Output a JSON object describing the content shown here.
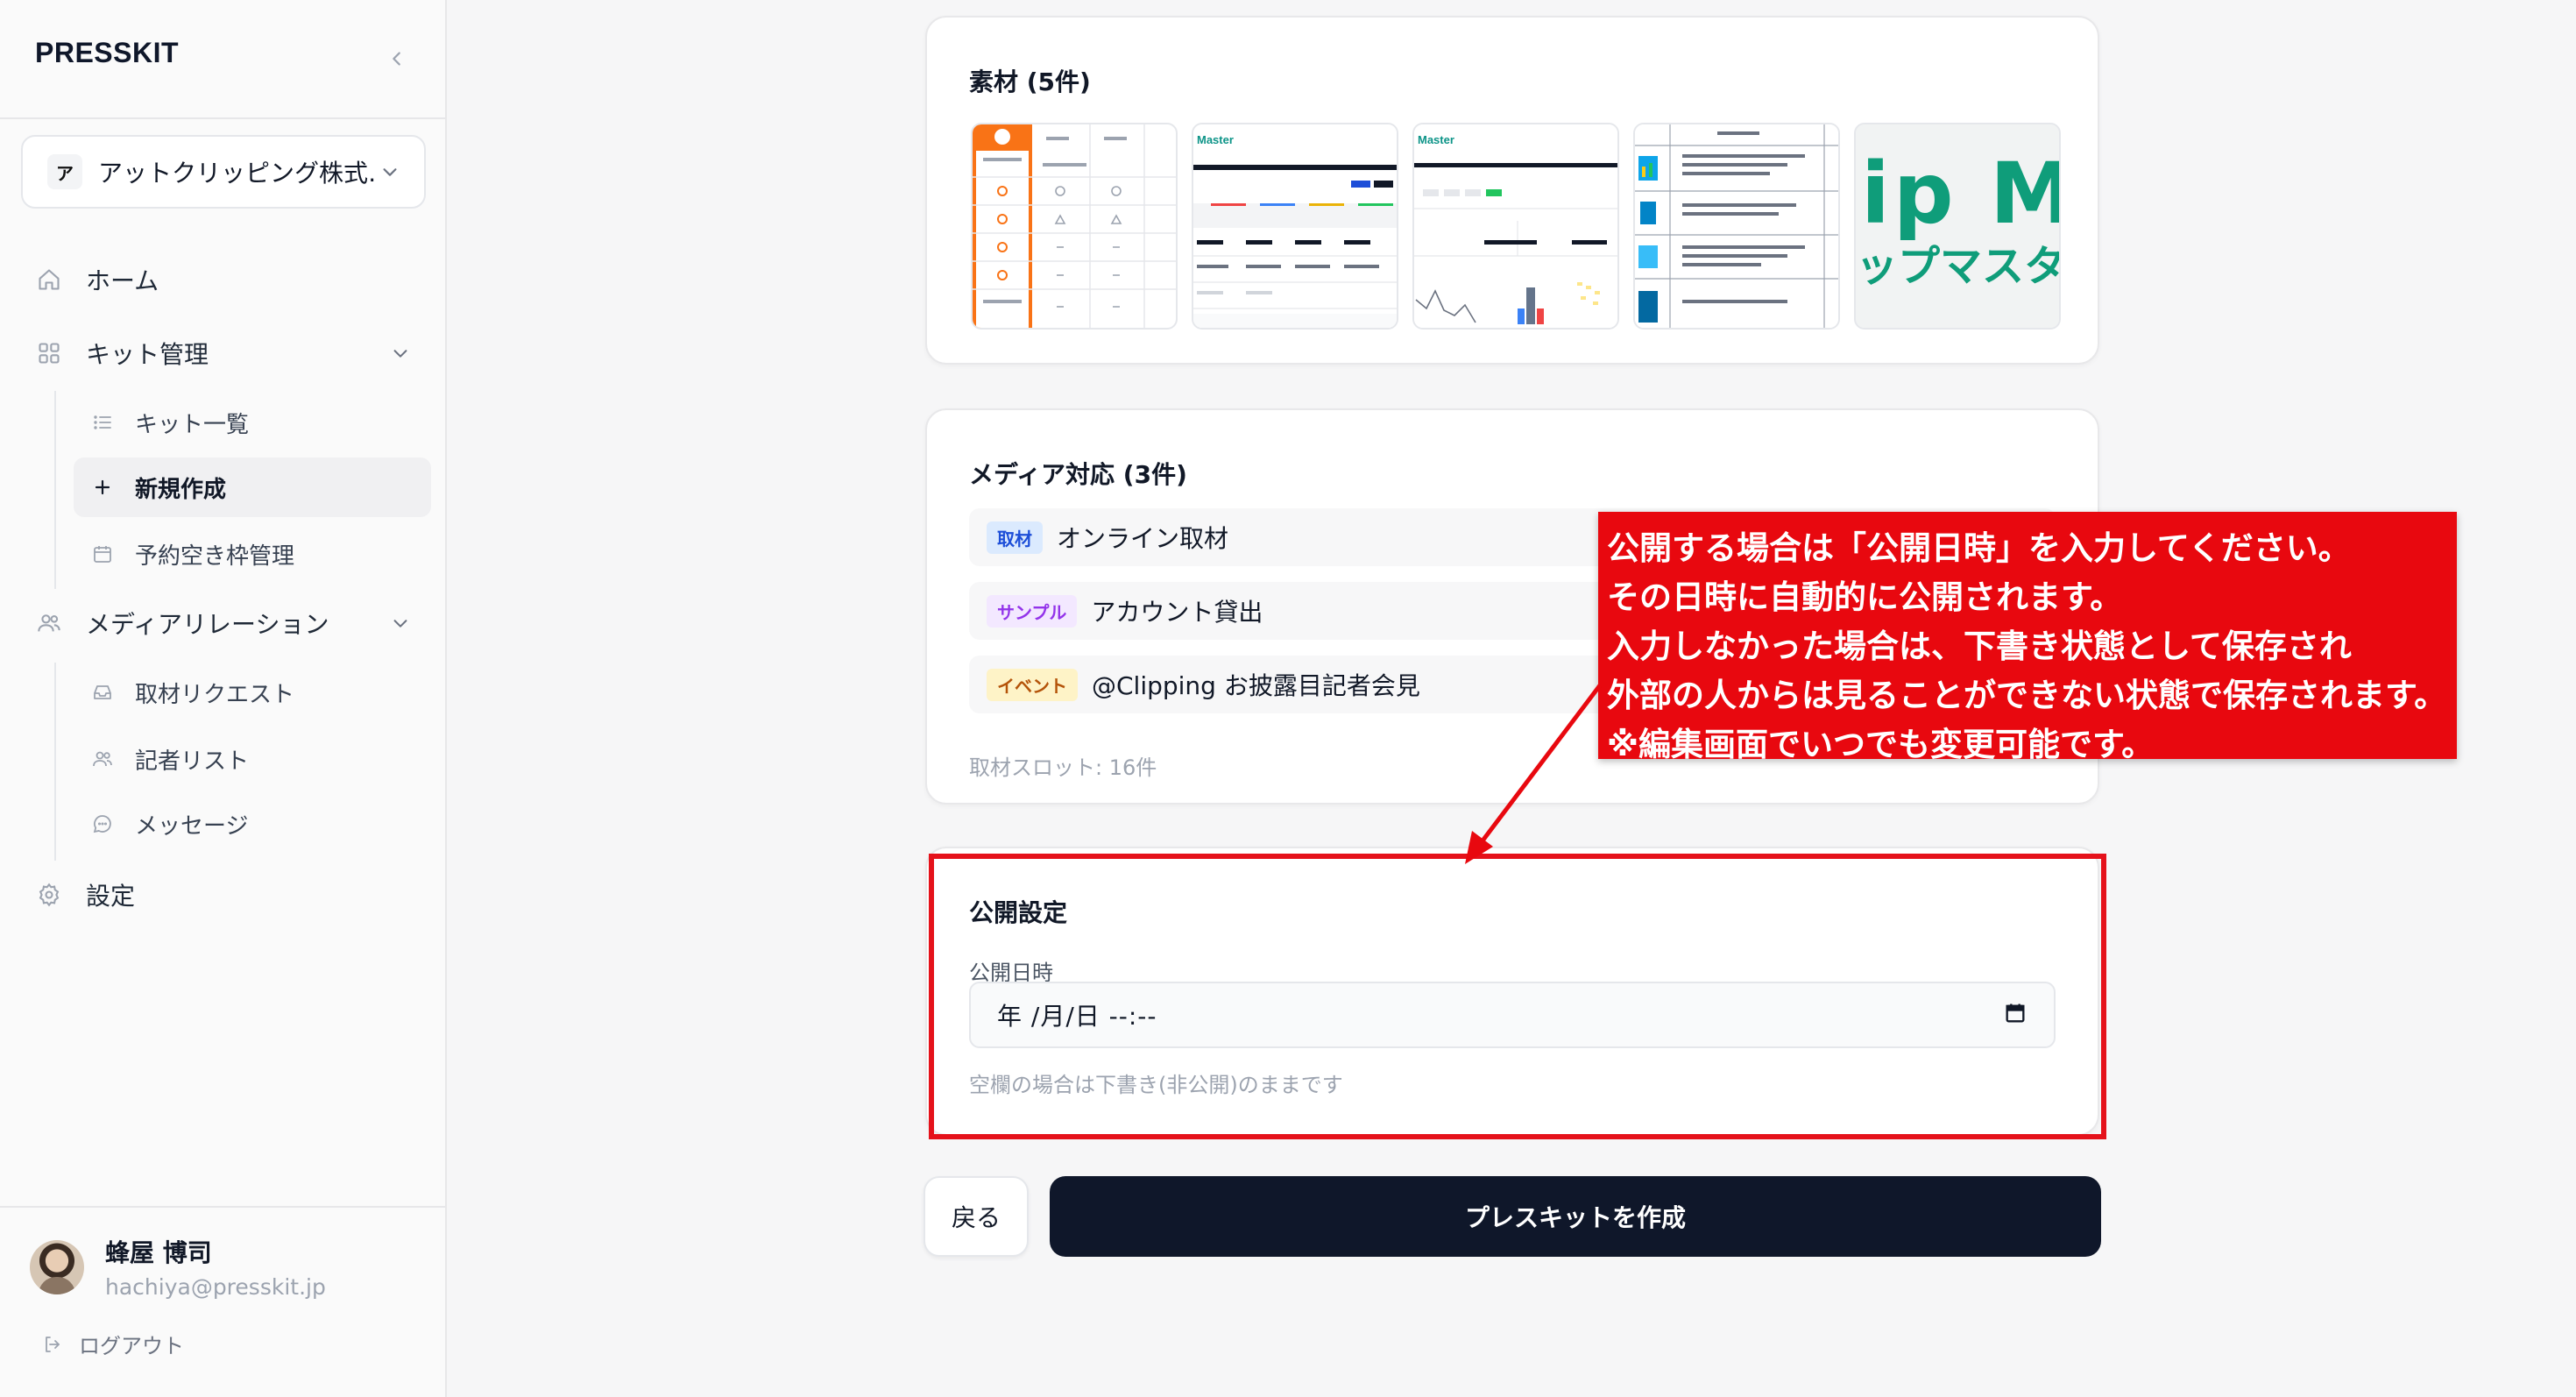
{
  "app": {
    "brand": "PRESSKIT"
  },
  "org": {
    "avatar_letter": "ア",
    "name": "アットクリッピング株式…"
  },
  "nav": {
    "home": "ホーム",
    "kit_manage": "キット管理",
    "kit_list": "キット一覧",
    "new_create": "新規作成",
    "reservation": "予約空き枠管理",
    "media_relations": "メディアリレーション",
    "interview_requests": "取材リクエスト",
    "reporter_list": "記者リスト",
    "messages": "メッセージ",
    "settings": "設定"
  },
  "user": {
    "name": "蜂屋 博司",
    "email": "hachiya@presskit.jp",
    "logout": "ログアウト"
  },
  "materials": {
    "title": "素材 (5件)",
    "thumbs": [
      "material-1",
      "material-2",
      "material-3",
      "material-4",
      "material-5"
    ]
  },
  "media": {
    "title": "メディア対応 (3件)",
    "items": [
      {
        "badge": "取材",
        "label": "オンライン取材",
        "badge_bg": "#dbeafe",
        "badge_fg": "#1d4ed8"
      },
      {
        "badge": "サンプル",
        "label": "アカウント貸出",
        "badge_bg": "#f3e8ff",
        "badge_fg": "#9333ea"
      },
      {
        "badge": "イベント",
        "label": "@Clipping お披露目記者会見",
        "badge_bg": "#fef3c7",
        "badge_fg": "#b45309"
      }
    ],
    "slots": "取材スロット: 16件"
  },
  "publish": {
    "title": "公開設定",
    "field_label": "公開日時",
    "date_value": "年 /月/日 --:--",
    "hint": "空欄の場合は下書き(非公開)のままです"
  },
  "actions": {
    "back": "戻る",
    "create": "プレスキットを作成"
  },
  "callout": {
    "lines": [
      "公開する場合は「公開日時」を入力してください。",
      "その日時に自動的に公開されます。",
      "入力しなかった場合は、下書き状態として保存され",
      "外部の人からは見ることができない状態で保存されます。",
      "※編集画面でいつでも変更可能です。"
    ]
  },
  "colors": {
    "accent": "#0f172a",
    "annotation_red": "#e8080f"
  }
}
